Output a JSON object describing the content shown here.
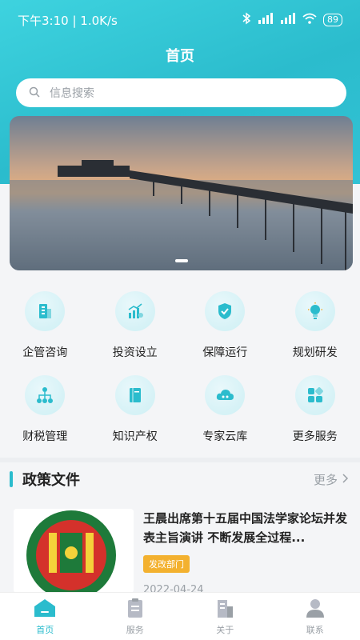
{
  "status": {
    "time_speed": "下午3:10 | 1.0K/s",
    "battery": "89"
  },
  "header": {
    "title": "首页"
  },
  "search": {
    "placeholder": "信息搜索"
  },
  "menu": [
    {
      "label": "企管咨询",
      "icon": "building-icon"
    },
    {
      "label": "投资设立",
      "icon": "growth-chart-icon"
    },
    {
      "label": "保障运行",
      "icon": "shield-check-icon"
    },
    {
      "label": "规划研发",
      "icon": "lightbulb-icon"
    },
    {
      "label": "财税管理",
      "icon": "org-chart-icon"
    },
    {
      "label": "知识产权",
      "icon": "book-icon"
    },
    {
      "label": "专家云库",
      "icon": "cloud-icon"
    },
    {
      "label": "更多服务",
      "icon": "apps-grid-icon"
    }
  ],
  "policy": {
    "title": "政策文件",
    "more": "更多",
    "article": {
      "title": "王晨出席第十五届中国法学家论坛并发表主旨演讲 不断发展全过程...",
      "tag": "发改部门",
      "date": "2022-04-24"
    }
  },
  "tabs": [
    {
      "label": "首页",
      "active": true
    },
    {
      "label": "服务",
      "active": false
    },
    {
      "label": "关于",
      "active": false
    },
    {
      "label": "联系",
      "active": false
    }
  ],
  "colors": {
    "accent": "#2bbccd",
    "tag": "#f3b12f"
  }
}
